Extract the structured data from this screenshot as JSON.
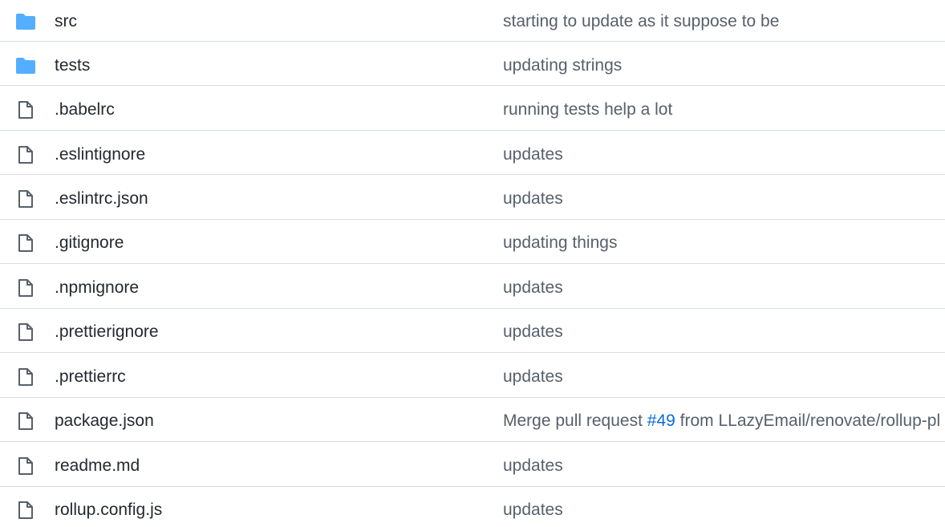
{
  "colors": {
    "folder_icon": "#54aeff",
    "file_icon": "#57606a",
    "name_text": "#24292f",
    "message_text": "#57606a",
    "link": "#0969da",
    "divider": "#d8dee4"
  },
  "files": [
    {
      "type": "folder",
      "icon": "folder-icon",
      "name": "src",
      "message": "starting to update as it suppose to be"
    },
    {
      "type": "folder",
      "icon": "folder-icon",
      "name": "tests",
      "message": "updating strings"
    },
    {
      "type": "file",
      "icon": "file-icon",
      "name": ".babelrc",
      "message": "running tests help a lot"
    },
    {
      "type": "file",
      "icon": "file-icon",
      "name": ".eslintignore",
      "message": "updates"
    },
    {
      "type": "file",
      "icon": "file-icon",
      "name": ".eslintrc.json",
      "message": "updates"
    },
    {
      "type": "file",
      "icon": "file-icon",
      "name": ".gitignore",
      "message": "updating things"
    },
    {
      "type": "file",
      "icon": "file-icon",
      "name": ".npmignore",
      "message": "updates"
    },
    {
      "type": "file",
      "icon": "file-icon",
      "name": ".prettierignore",
      "message": "updates"
    },
    {
      "type": "file",
      "icon": "file-icon",
      "name": ".prettierrc",
      "message": "updates"
    },
    {
      "type": "file",
      "icon": "file-icon",
      "name": "package.json",
      "message_prefix": "Merge pull request ",
      "message_link": "#49",
      "message_suffix": " from LLazyEmail/renovate/rollup-pl"
    },
    {
      "type": "file",
      "icon": "file-icon",
      "name": "readme.md",
      "message": "updates"
    },
    {
      "type": "file",
      "icon": "file-icon",
      "name": "rollup.config.js",
      "message": "updates"
    }
  ]
}
